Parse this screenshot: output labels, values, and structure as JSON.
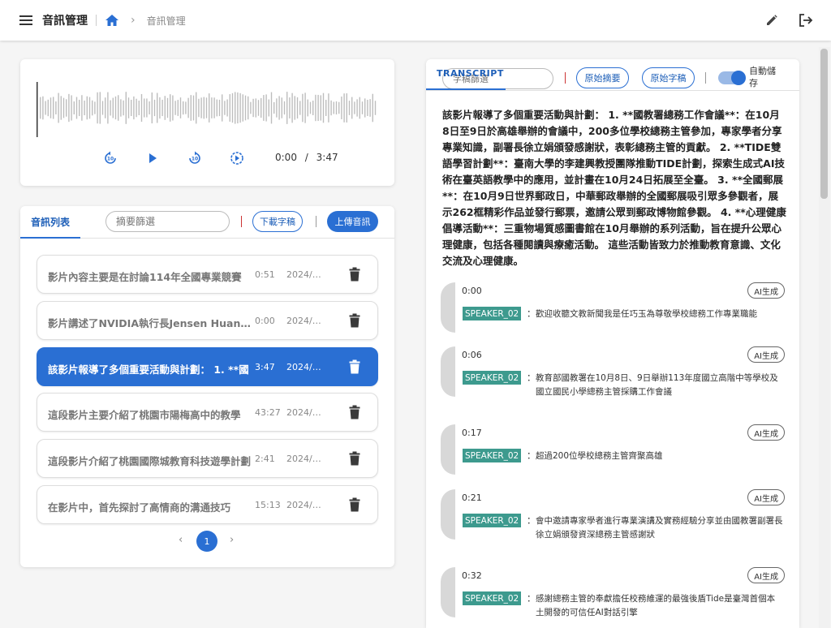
{
  "header": {
    "app_title": "音訊管理",
    "breadcrumb": "音訊管理"
  },
  "player": {
    "current_time": "0:00",
    "separator": "/",
    "duration": "3:47",
    "progress": 0
  },
  "audio_list": {
    "tab_label": "音訊列表",
    "filter_placeholder": "摘要篩選",
    "download_label": "下載字稿",
    "upload_label": "上傳音訊",
    "items": [
      {
        "title": "影片內容主要是在討論114年全國專業競賽",
        "duration": "0:51",
        "date": "2024/1...",
        "active": false
      },
      {
        "title": "影片講述了NVIDIA執行長Jensen Huang在",
        "duration": "0:00",
        "date": "2024/1...",
        "active": false
      },
      {
        "title": "該影片報導了多個重要活動與計劃： 1. **國",
        "duration": "3:47",
        "date": "2024/1...",
        "active": true
      },
      {
        "title": "這段影片主要介紹了桃園市陽梅高中的教學",
        "duration": "43:27",
        "date": "2024/1...",
        "active": false
      },
      {
        "title": "這段影片介紹了桃園國際城教育科技遊學計劃",
        "duration": "2:41",
        "date": "2024/1...",
        "active": false
      },
      {
        "title": "在影片中，首先探討了高情商的溝通技巧",
        "duration": "15:13",
        "date": "2024/0...",
        "active": false
      }
    ],
    "pager": {
      "prev": "‹",
      "page": "1",
      "next": "›"
    }
  },
  "transcript": {
    "search_placeholder": "字稿篩選",
    "tab_label": "TRANSCRIPT",
    "original_summary_label": "原始摘要",
    "original_transcript_label": "原始字稿",
    "autosave_label": "自動儲存",
    "autosave_on": true,
    "summary": "該影片報導了多個重要活動與計劃： 1. **國教署總務工作會議**：在10月8日至9日於高雄舉辦的會議中，200多位學校總務主管參加，專家學者分享專業知識，副署長徐立娟頒發感謝狀，表彰總務主管的貢獻。 2. **TIDE雙語學習計劃**：臺南大學的李建興教授團隊推動TIDE計劃，探索生成式AI技術在臺英語教學中的應用，並計畫在10月24日拓展至全臺。 3. **全國郵展**：在10月9日世界郵政日，中華郵政舉辦的全國郵展吸引眾多參觀者，展示262框精彩作品並發行郵票，邀請公眾到郵政博物館參觀。 4. **心理健康倡導活動**：三重物場質感圖書館在10月舉辦的系列活動，旨在提升公眾心理健康，包括各種閱讀與療癒活動。 這些活動皆致力於推動教育意識、文化交流及心理健康。",
    "ai_label": "AI生成",
    "segments": [
      {
        "time": "0:00",
        "speaker": "SPEAKER_02",
        "text": "歡迎收聽文教新聞我是任巧玉為尊敬學校總務工作專業職能"
      },
      {
        "time": "0:06",
        "speaker": "SPEAKER_02",
        "text": "教育部國教署在10月8日、9日舉辦113年度國立高階中等學校及國立國民小學總務主管採購工作會議"
      },
      {
        "time": "0:17",
        "speaker": "SPEAKER_02",
        "text": "超過200位學校總務主管齊聚高雄"
      },
      {
        "time": "0:21",
        "speaker": "SPEAKER_02",
        "text": "會中邀請專家學者進行專業演講及實務經驗分享並由國教署副署長徐立娟頒發資深總務主管感謝狀"
      },
      {
        "time": "0:32",
        "speaker": "SPEAKER_02",
        "text": "感謝總務主管的奉獻擔任校務維運的最強後盾Tide是臺灣首個本土開發的可信任AI對話引擎"
      }
    ]
  },
  "colors": {
    "primary": "#2a6fd3",
    "speaker_tag": "#3d9a8e",
    "divider_red": "#cc3333"
  },
  "icons": [
    "menu-icon",
    "home-icon",
    "chevron-right-icon",
    "edit-icon",
    "logout-icon",
    "replay-10-icon",
    "play-icon",
    "forward-10-icon",
    "speed-icon",
    "trash-icon"
  ]
}
